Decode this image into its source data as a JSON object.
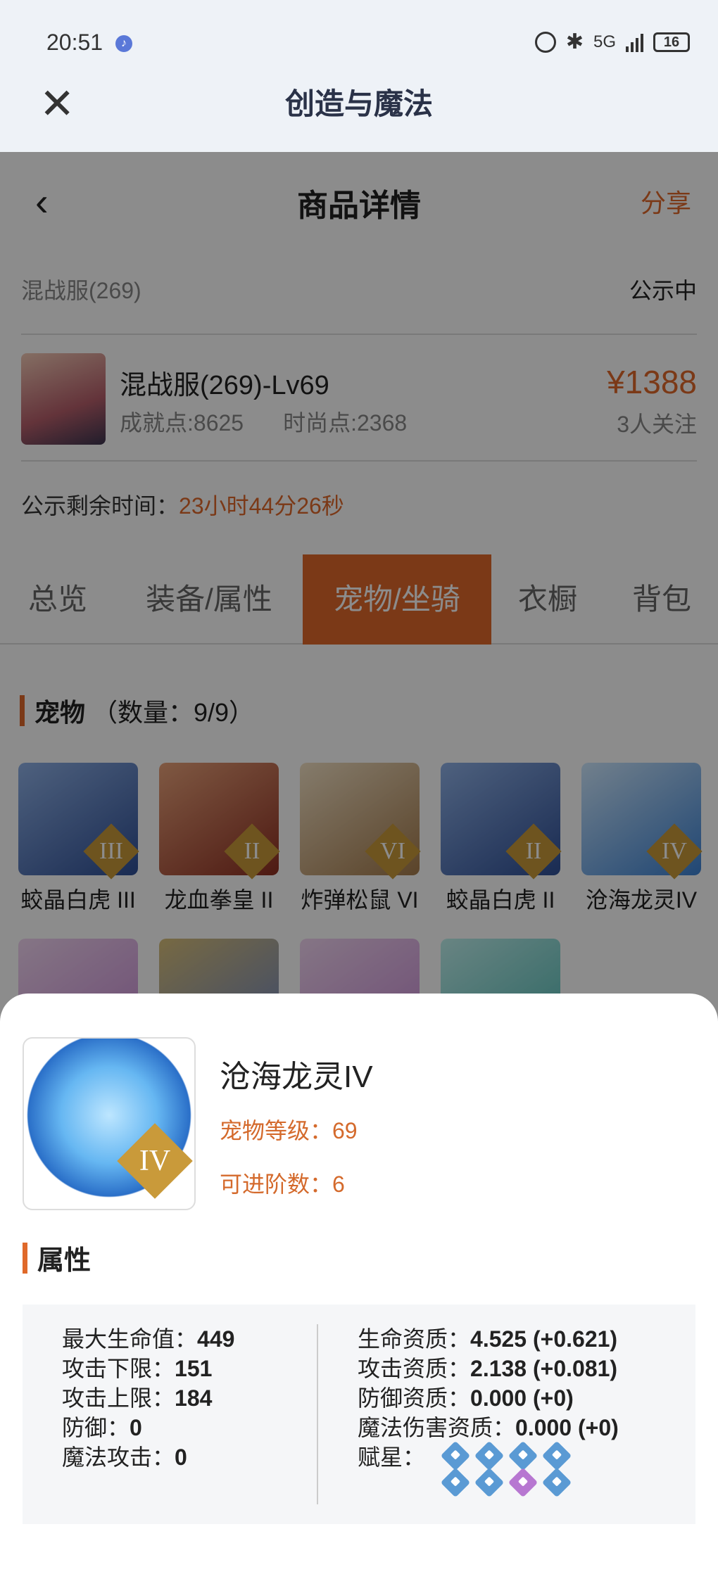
{
  "status": {
    "time": "20:51",
    "network": "5G",
    "battery": "16"
  },
  "app": {
    "title": "创造与魔法"
  },
  "nav": {
    "title": "商品详情",
    "share": "分享"
  },
  "server": {
    "name": "混战服(269)",
    "status": "公示中"
  },
  "character": {
    "name": "混战服(269)-Lv69",
    "achievement": "成就点:8625",
    "fashion": "时尚点:2368",
    "price": "¥1388",
    "followers": "3人关注"
  },
  "remaining": {
    "label": "公示剩余时间：",
    "time": "23小时44分26秒"
  },
  "tabs": [
    "总览",
    "装备/属性",
    "宠物/坐骑",
    "衣橱",
    "背包"
  ],
  "active_tab": 2,
  "pets": {
    "title": "宠物",
    "count": "（数量：9/9）",
    "items": [
      {
        "name": "蛟晶白虎 III",
        "rank": "III",
        "color": "#4b6fb5"
      },
      {
        "name": "龙血拳皇 II",
        "rank": "II",
        "color": "#b84a3a"
      },
      {
        "name": "炸弹松鼠 VI",
        "rank": "VI",
        "color": "#c9a87a"
      },
      {
        "name": "蛟晶白虎 II",
        "rank": "II",
        "color": "#4b6fb5"
      },
      {
        "name": "沧海龙灵IV",
        "rank": "IV",
        "color": "#62a9e6"
      }
    ]
  },
  "sheet": {
    "name": "沧海龙灵IV",
    "rank": "IV",
    "level": "宠物等级：69",
    "stage": "可进阶数：6",
    "attr_title": "属性",
    "left": [
      {
        "label": "最大生命值：",
        "value": "449"
      },
      {
        "label": "攻击下限：",
        "value": "151"
      },
      {
        "label": "攻击上限：",
        "value": "184"
      },
      {
        "label": "防御：",
        "value": "0"
      },
      {
        "label": "魔法攻击：",
        "value": "0"
      }
    ],
    "right": [
      {
        "label": "生命资质：",
        "value": "4.525 (+0.621)"
      },
      {
        "label": "攻击资质：",
        "value": "2.138 (+0.081)"
      },
      {
        "label": "防御资质：",
        "value": "0.000 (+0)"
      },
      {
        "label": "魔法伤害资质：",
        "value": "0.000 (+0)"
      }
    ],
    "star_label": "赋星："
  }
}
